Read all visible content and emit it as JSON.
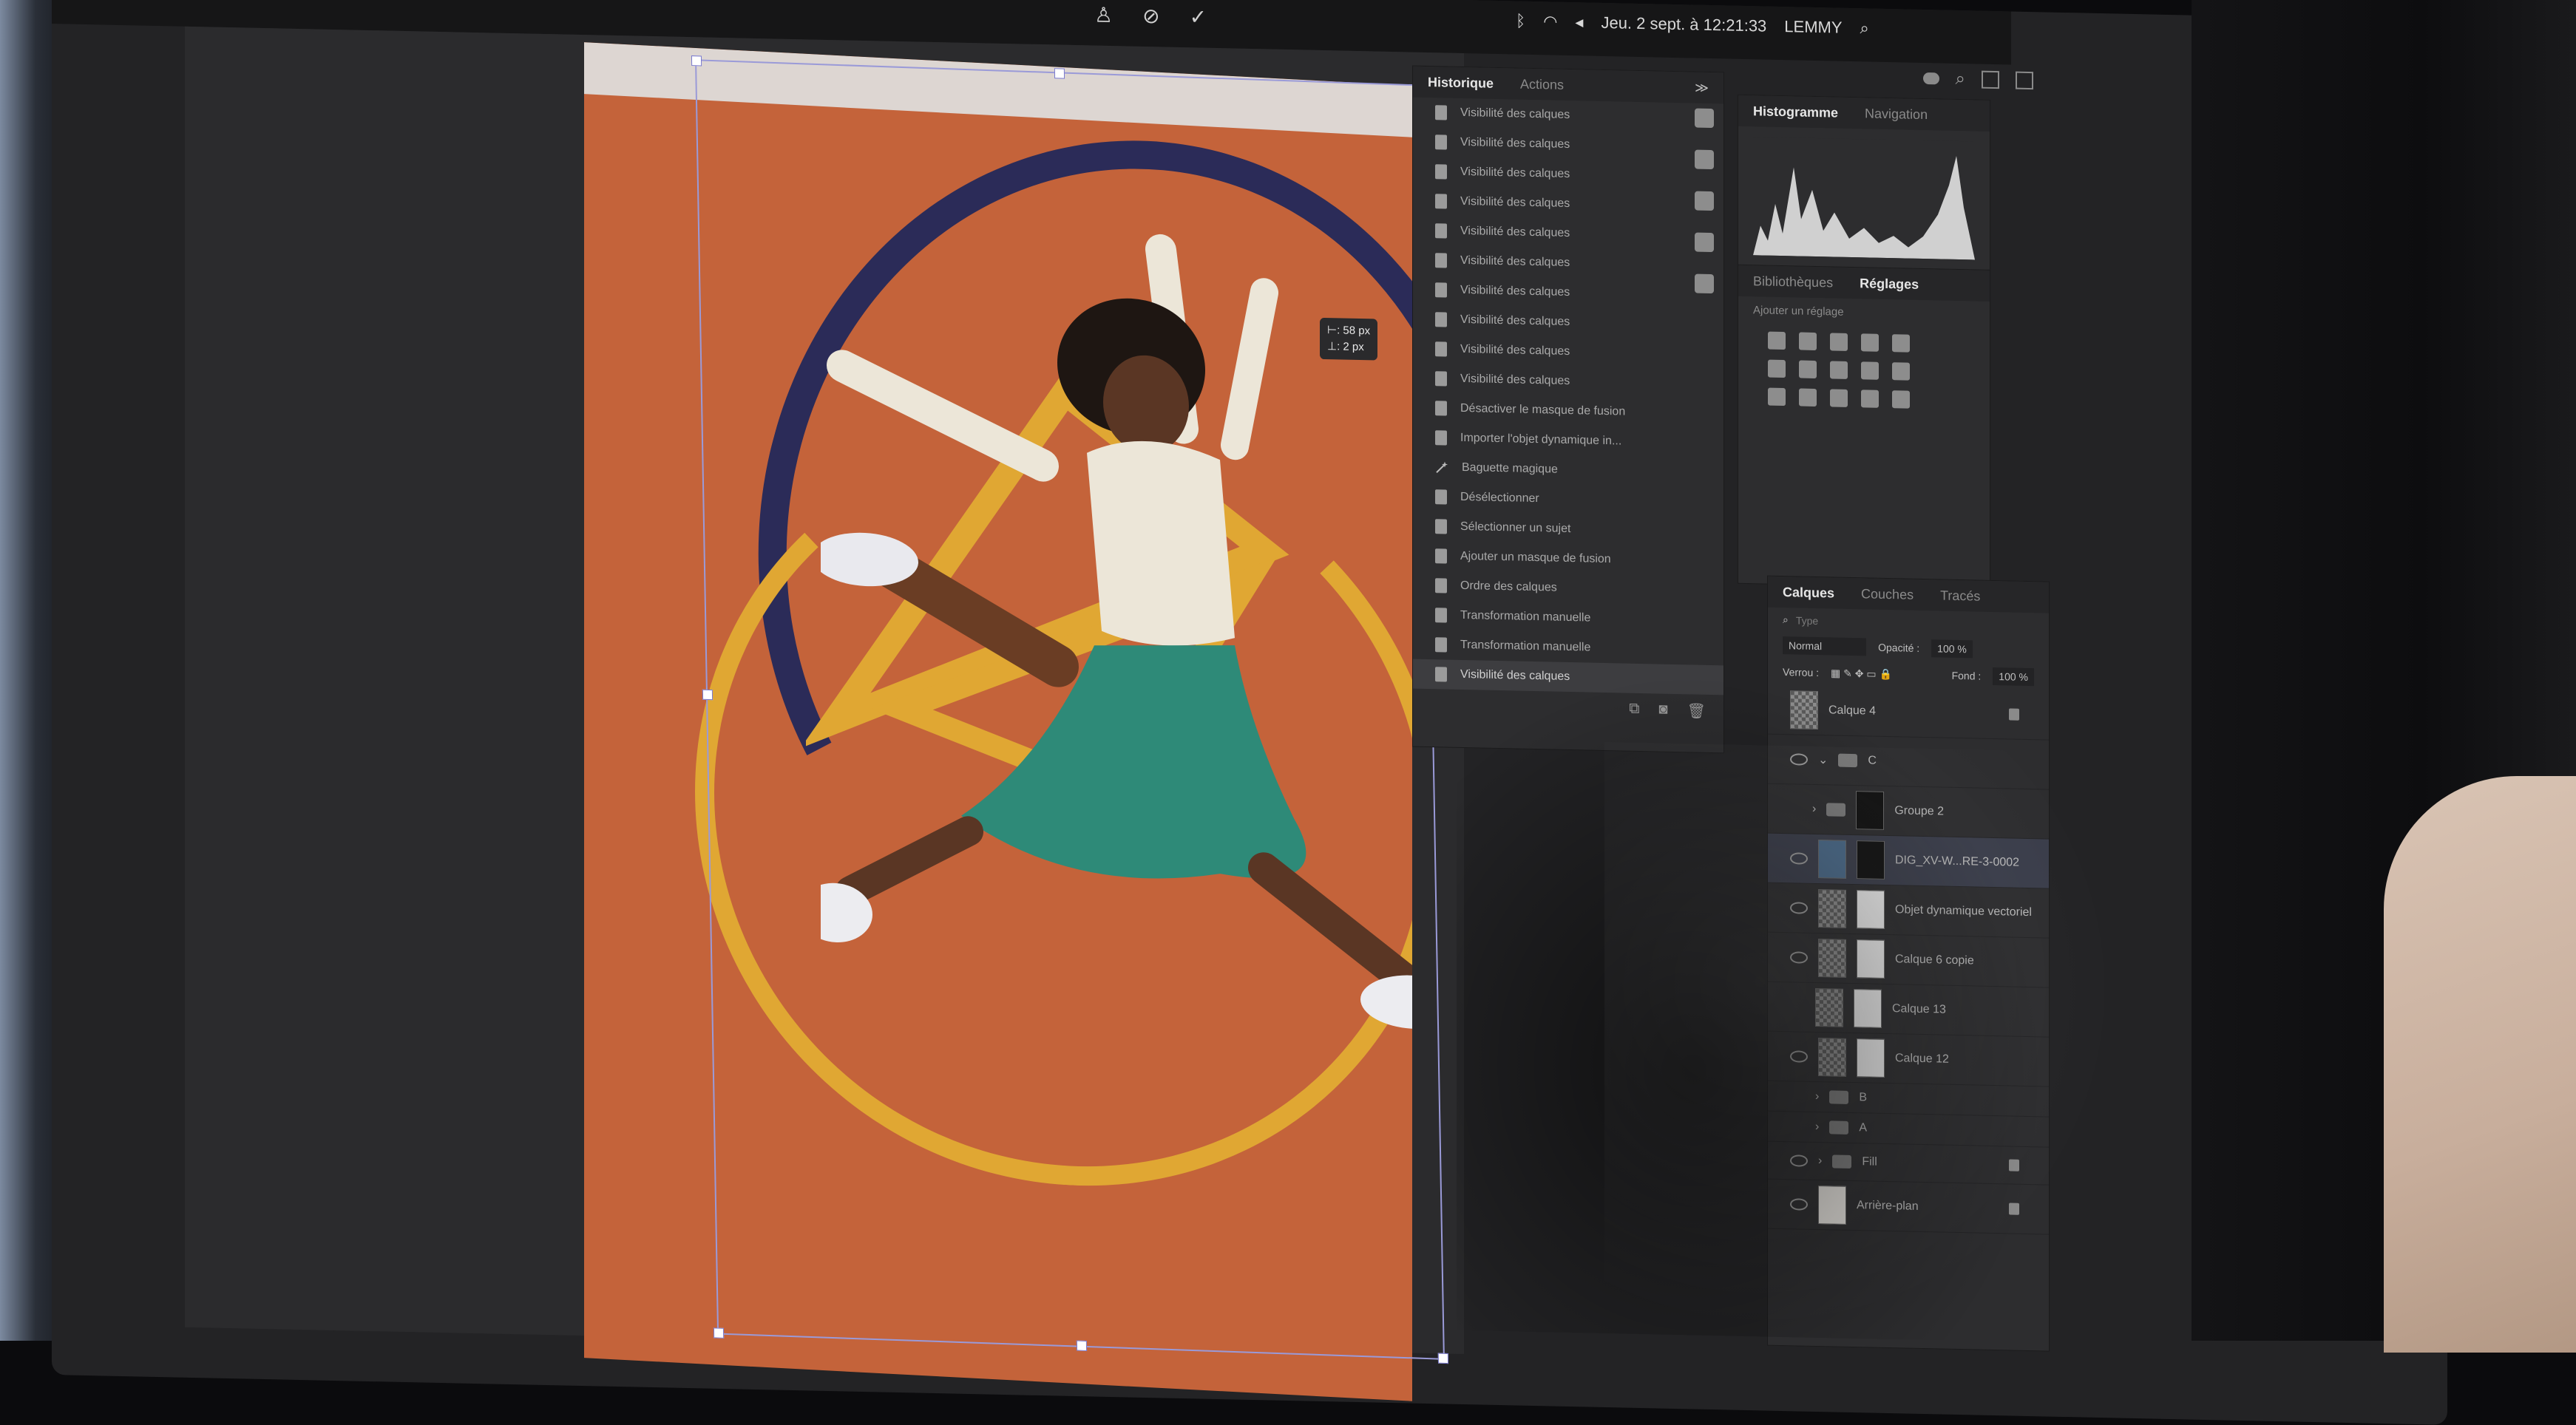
{
  "menubar": {
    "date_time": "Jeu. 2 sept. à 12:21:33",
    "user": "LEMMY"
  },
  "tooltip": {
    "line1": "⊢: 58 px",
    "line2": "⊥: 2 px"
  },
  "history_panel": {
    "tabs": [
      "Historique",
      "Actions"
    ],
    "items": [
      {
        "label": "Visibilité des calques",
        "icon": "doc-icon"
      },
      {
        "label": "Visibilité des calques",
        "icon": "doc-icon"
      },
      {
        "label": "Visibilité des calques",
        "icon": "doc-icon"
      },
      {
        "label": "Visibilité des calques",
        "icon": "doc-icon"
      },
      {
        "label": "Visibilité des calques",
        "icon": "doc-icon"
      },
      {
        "label": "Visibilité des calques",
        "icon": "doc-icon"
      },
      {
        "label": "Visibilité des calques",
        "icon": "doc-icon"
      },
      {
        "label": "Visibilité des calques",
        "icon": "doc-icon"
      },
      {
        "label": "Visibilité des calques",
        "icon": "doc-icon"
      },
      {
        "label": "Visibilité des calques",
        "icon": "doc-icon"
      },
      {
        "label": "Désactiver le masque de fusion",
        "icon": "doc-icon"
      },
      {
        "label": "Importer l'objet dynamique in...",
        "icon": "doc-icon"
      },
      {
        "label": "Baguette magique",
        "icon": "magic-wand-icon"
      },
      {
        "label": "Désélectionner",
        "icon": "doc-icon"
      },
      {
        "label": "Sélectionner un sujet",
        "icon": "doc-icon"
      },
      {
        "label": "Ajouter un masque de fusion",
        "icon": "doc-icon"
      },
      {
        "label": "Ordre des calques",
        "icon": "doc-icon"
      },
      {
        "label": "Transformation manuelle",
        "icon": "doc-icon"
      },
      {
        "label": "Transformation manuelle",
        "icon": "doc-icon"
      },
      {
        "label": "Visibilité des calques",
        "icon": "doc-icon",
        "selected": true
      }
    ]
  },
  "histogram_panel": {
    "tabs": [
      "Histogramme",
      "Navigation"
    ]
  },
  "adjustments_panel": {
    "tabs": [
      "Bibliothèques",
      "Réglages"
    ],
    "subtitle": "Ajouter un réglage"
  },
  "layers_panel": {
    "tabs": [
      "Calques",
      "Couches",
      "Tracés"
    ],
    "search_placeholder": "Type",
    "blend_mode": "Normal",
    "opacity_label": "Opacité :",
    "opacity_value": "100 %",
    "lock_label": "Verrou :",
    "fill_label": "Fond :",
    "fill_value": "100 %",
    "layers": [
      {
        "name": "Calque 4",
        "type": "layer",
        "locked": true
      },
      {
        "name": "C",
        "type": "group"
      },
      {
        "name": "Groupe 2",
        "type": "group"
      },
      {
        "name": "DIG_XV-W...RE-3-0002",
        "type": "layer",
        "selected": true
      },
      {
        "name": "Objet dynamique vectoriel",
        "type": "smart-object"
      },
      {
        "name": "Calque 6 copie",
        "type": "layer"
      },
      {
        "name": "Calque 13",
        "type": "layer"
      },
      {
        "name": "Calque 12",
        "type": "layer"
      },
      {
        "name": "B",
        "type": "group"
      },
      {
        "name": "A",
        "type": "group"
      },
      {
        "name": "Fill",
        "type": "group",
        "locked": true
      },
      {
        "name": "Arrière-plan",
        "type": "layer",
        "locked": true
      }
    ]
  },
  "colors": {
    "artboard_orange": "#c4633a",
    "arc_navy": "#2b2b58",
    "ring_yellow": "#e0a733",
    "skirt_teal": "#2e8a78"
  }
}
